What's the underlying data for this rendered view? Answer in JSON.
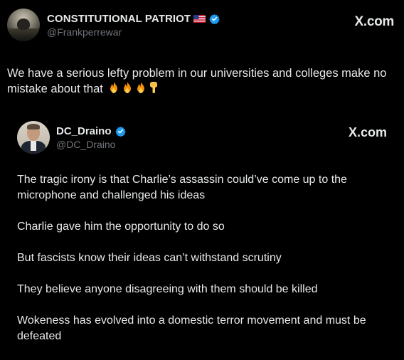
{
  "outer_tweet": {
    "display_name": "CONSTITUTIONAL PATRIOT",
    "handle": "@Frankperrewar",
    "site_label": "X.com",
    "text": "We have a serious lefty problem in our universities and colleges make no mistake about that",
    "emojis": [
      "fire-emoji",
      "fire-emoji",
      "fire-emoji",
      "pointing-down-emoji"
    ],
    "badge_icon": "verified-badge-icon",
    "flag_icon": "us-flag-icon"
  },
  "quoted_tweet": {
    "display_name": "DC_Draino",
    "handle": "@DC_Draino",
    "site_label": "X.com",
    "badge_icon": "verified-badge-icon",
    "paragraphs": [
      "The tragic irony is that Charlie’s assassin could’ve come up to the microphone and challenged his ideas",
      "Charlie gave him the opportunity to do so",
      "But fascists know their ideas can’t withstand scrutiny",
      "They believe anyone disagreeing with them should be killed",
      "Wokeness has evolved into a domestic terror movement and must be defeated"
    ]
  },
  "colors": {
    "background": "#000000",
    "text": "#e7e9ea",
    "secondary_text": "#71767b",
    "verified_blue": "#1d9bf0"
  }
}
